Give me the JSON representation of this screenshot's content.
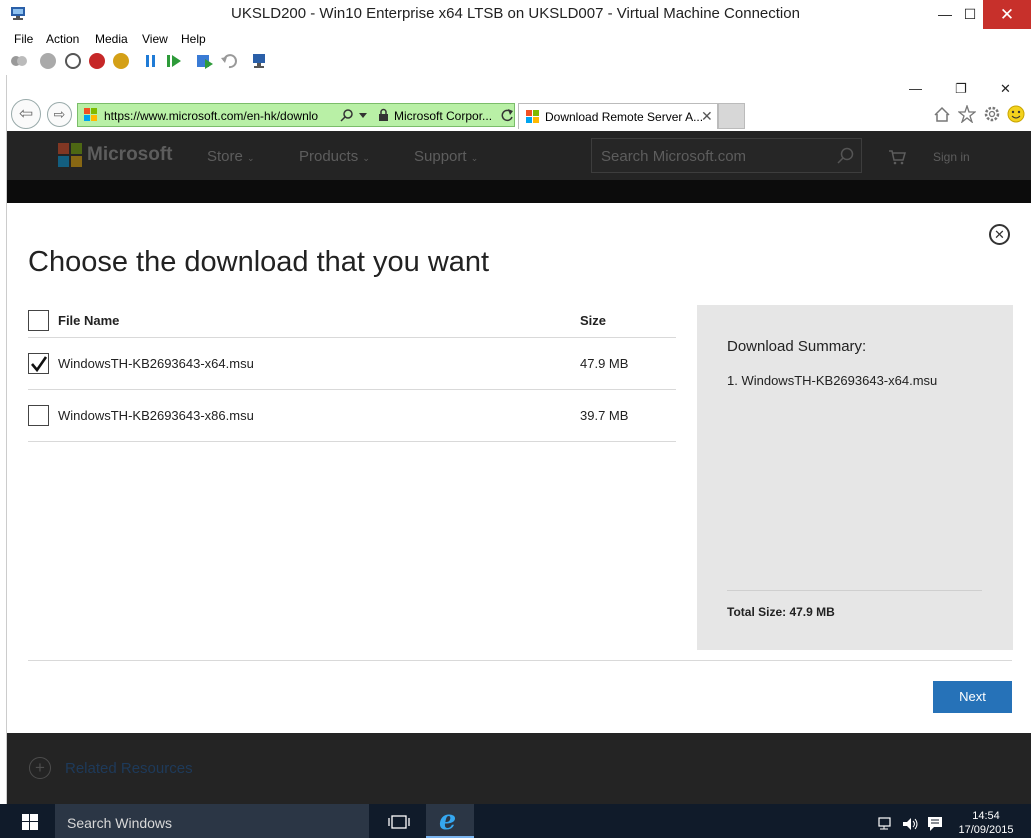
{
  "window": {
    "title": "UKSLD200 - Win10 Enterprise x64 LTSB on UKSLD007 - Virtual Machine Connection",
    "minimize": "—",
    "maximize": "☐",
    "close": "✕"
  },
  "menu": [
    "File",
    "Action",
    "Media",
    "View",
    "Help"
  ],
  "browser": {
    "url": "https://www.microsoft.com/en-hk/downlo",
    "certificate": "Microsoft Corpor...",
    "tab_title": "Download Remote Server A...",
    "tab_close": "✕",
    "win_minimize": "—",
    "win_maximize": "❐",
    "win_close": "✕"
  },
  "ms_header": {
    "brand": "Microsoft",
    "nav": [
      "Store",
      "Products",
      "Support"
    ],
    "search_placeholder": "Search Microsoft.com",
    "sign_in": "Sign in"
  },
  "dialog": {
    "title": "Choose the download that you want",
    "close": "✕",
    "columns": {
      "file_name": "File Name",
      "size": "Size"
    },
    "files": [
      {
        "name": "WindowsTH-KB2693643-x64.msu",
        "size": "47.9 MB",
        "checked": true
      },
      {
        "name": "WindowsTH-KB2693643-x86.msu",
        "size": "39.7 MB",
        "checked": false
      }
    ],
    "summary": {
      "title": "Download Summary:",
      "items": [
        "1. WindowsTH-KB2693643-x64.msu"
      ],
      "total": "Total Size: 47.9 MB"
    },
    "next": "Next"
  },
  "related": {
    "label": "Related Resources",
    "icon": "plus-icon"
  },
  "taskbar": {
    "search": "Search Windows",
    "time": "14:54",
    "date": "17/09/2015"
  }
}
